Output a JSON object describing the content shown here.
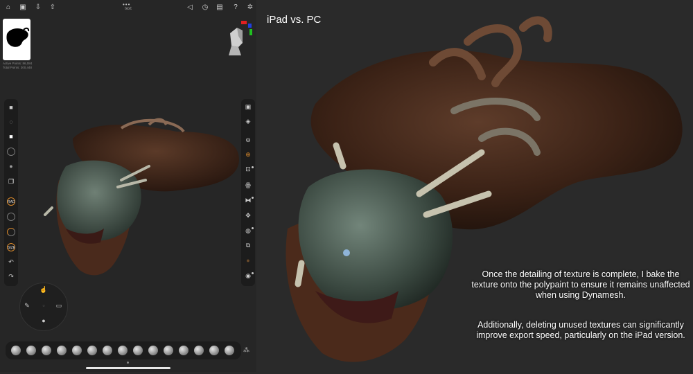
{
  "app": {
    "title": "text",
    "stats": {
      "active_points": "Active Points: 86,084",
      "total_points": "Total Points: 300,448"
    },
    "topbar_left_icons": [
      "home-icon",
      "save-icon",
      "export-icon",
      "share-icon"
    ],
    "topbar_right_icons": [
      "megaphone-icon",
      "history-icon",
      "layout-icon",
      "help-icon",
      "settings-icon"
    ]
  },
  "left_tools": [
    "cube-icon",
    "lasso-icon",
    "square-icon",
    "sphere-outline-icon",
    "sphere-icon",
    "layers-icon",
    "radius-ring",
    "intensity-ring",
    "hardness-ring",
    "size-ring",
    "undo-icon",
    "redo-icon"
  ],
  "right_tools": [
    "scene-icon",
    "layers-icon",
    "more-icon",
    "grid-icon",
    "frame-icon",
    "symmetry-icon",
    "symmetry-x-icon",
    "fullscreen-icon",
    "topology-icon",
    "copy-icon",
    "paint-icon",
    "camera-icon"
  ],
  "brushes": [
    "clay",
    "standard",
    "inflate",
    "smooth",
    "flatten",
    "crease",
    "pinch",
    "layer",
    "blob",
    "move",
    "drag",
    "trim",
    "snake",
    "stamp",
    "twist"
  ],
  "ring_labels": {
    "radius": "RAD",
    "intensity": "INT",
    "size": "SIZE"
  },
  "heading": "iPad vs. PC",
  "caption_1": "Once the detailing of texture is complete, I bake the texture onto the polypaint to ensure it remains unaffected when using Dynamesh.",
  "caption_2": "Additionally, deleting unused textures can significantly improve export speed, particularly on the iPad version.",
  "colors": {
    "accent": "#d9892b",
    "panel": "#1c1c1c",
    "background": "#2a2a2a"
  }
}
